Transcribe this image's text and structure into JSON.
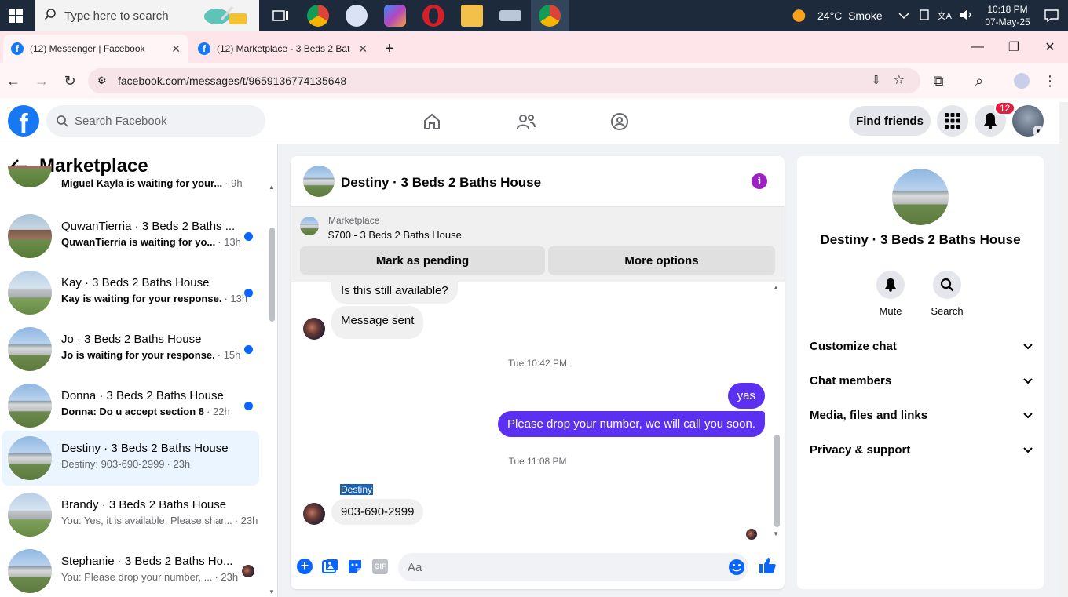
{
  "taskbar": {
    "search_placeholder": "Type here to search",
    "weather": "24°C  Smoke",
    "time": "10:18 PM",
    "date": "07-May-25"
  },
  "browser": {
    "tabs": [
      {
        "title": "(12) Messenger | Facebook"
      },
      {
        "title": "(12) Marketplace - 3 Beds 2 Bat"
      }
    ],
    "url": "facebook.com/messages/t/9659136774135648"
  },
  "fb_header": {
    "search_placeholder": "Search Facebook",
    "find_friends_label": "Find friends",
    "notification_count": "12"
  },
  "left_panel": {
    "title": "Marketplace",
    "conversations": [
      {
        "name": "",
        "preview": "Miguel Kayla is waiting for your...",
        "time": "· 9h",
        "unread": true
      },
      {
        "name": "QuwanTierria · 3 Beds 2 Baths ...",
        "preview": "QuwanTierria is waiting for yo...",
        "time": "· 13h",
        "unread": true
      },
      {
        "name": "Kay · 3 Beds 2 Baths House",
        "preview": "Kay is waiting for your response.",
        "time": "· 13h",
        "unread": true
      },
      {
        "name": "Jo · 3 Beds 2 Baths House",
        "preview": "Jo is waiting for your response.",
        "time": "· 15h",
        "unread": true
      },
      {
        "name": "Donna · 3 Beds 2 Baths House",
        "preview": "Donna: Do u accept section 8",
        "time": "· 22h",
        "unread": true
      },
      {
        "name": "Destiny · 3 Beds 2 Baths House",
        "preview": "Destiny: 903-690-2999",
        "time": "· 23h",
        "unread": false
      },
      {
        "name": "Brandy · 3 Beds 2 Baths House",
        "preview": "You: Yes, it is available. Please shar...",
        "time": "· 23h",
        "unread": false
      },
      {
        "name": "Stephanie · 3 Beds 2 Baths Ho...",
        "preview": "You: Please drop your number, ...",
        "time": "· 23h",
        "unread": false
      }
    ]
  },
  "chat": {
    "title": "Destiny · 3 Beds 2 Baths House",
    "marketplace_label": "Marketplace",
    "listing": "$700 - 3 Beds 2 Baths House",
    "mark_pending_label": "Mark as pending",
    "more_options_label": "More options",
    "messages": [
      {
        "text": "Is this still available?",
        "dir": "in"
      },
      {
        "text": "Message sent",
        "dir": "in"
      },
      {
        "text": "Tue 10:42 PM",
        "dir": "ts"
      },
      {
        "text": "yas",
        "dir": "out"
      },
      {
        "text": "Please drop your number, we will call you soon.",
        "dir": "out"
      },
      {
        "text": "Tue 11:08 PM",
        "dir": "ts"
      },
      {
        "text": "Destiny",
        "dir": "sender"
      },
      {
        "text": "903-690-2999",
        "dir": "in"
      }
    ],
    "composer_placeholder": "Aa"
  },
  "right_panel": {
    "name": "Destiny · 3 Beds 2 Baths House",
    "mute_label": "Mute",
    "search_label": "Search",
    "sections": [
      "Customize chat",
      "Chat members",
      "Media, files and links",
      "Privacy & support"
    ]
  },
  "colors": {
    "fb_blue": "#1877f2",
    "messenger_purple": "#5b30f0",
    "unread_dot": "#0866ff",
    "tab_bar": "#fde5ea"
  }
}
